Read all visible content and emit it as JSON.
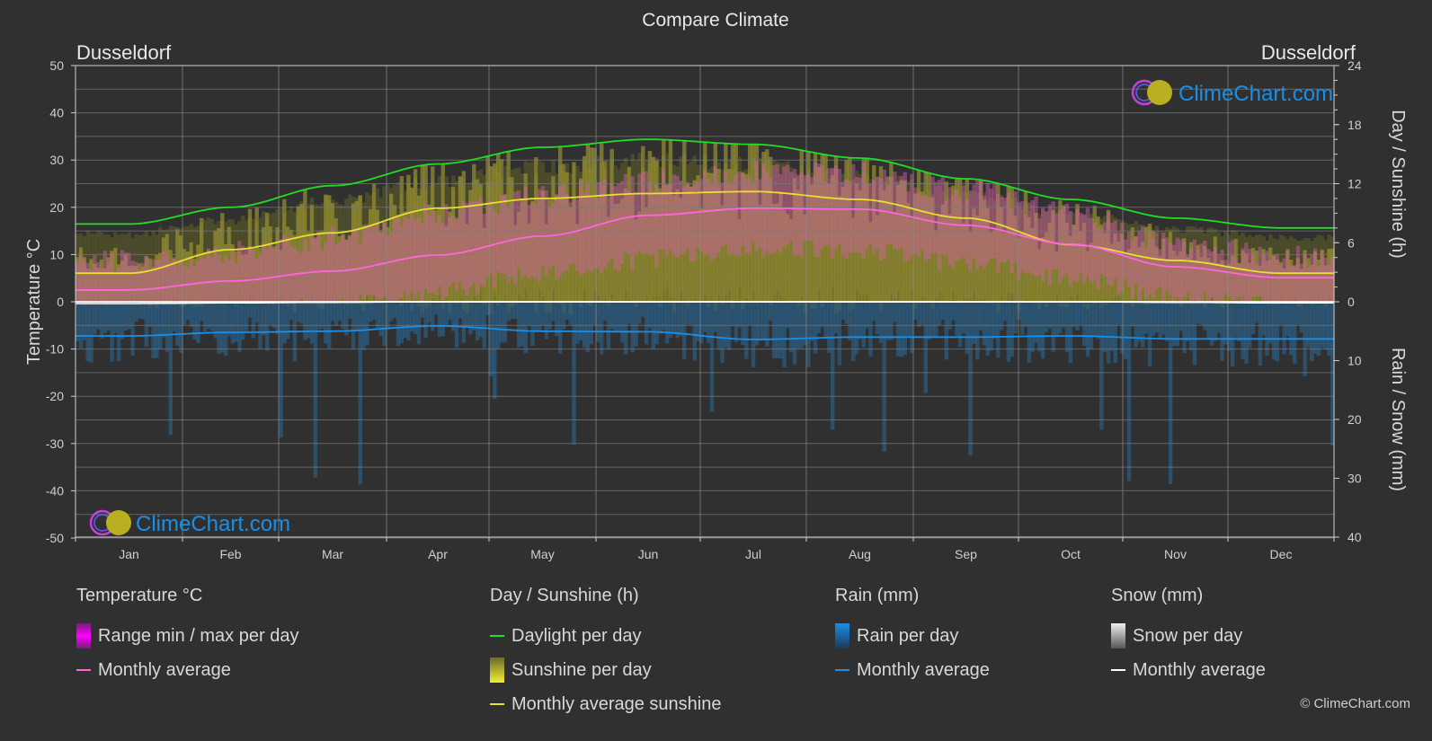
{
  "chart_data": {
    "type": "line",
    "title": "Compare Climate",
    "location_left": "Dusseldorf",
    "location_right": "Dusseldorf",
    "categories": [
      "Jan",
      "Feb",
      "Mar",
      "Apr",
      "May",
      "Jun",
      "Jul",
      "Aug",
      "Sep",
      "Oct",
      "Nov",
      "Dec"
    ],
    "y_left": {
      "label": "Temperature °C",
      "range": [
        -50,
        50
      ],
      "ticks": [
        50,
        40,
        30,
        20,
        10,
        0,
        -10,
        -20,
        -30,
        -40,
        -50
      ]
    },
    "y_right_top": {
      "label": "Day / Sunshine (h)",
      "range": [
        0,
        24
      ],
      "ticks": [
        24,
        18,
        12,
        6,
        0
      ]
    },
    "y_right_bottom": {
      "label": "Rain / Snow (mm)",
      "range": [
        0,
        40
      ],
      "ticks": [
        0,
        10,
        20,
        30,
        40
      ]
    },
    "grid": true,
    "series": [
      {
        "name": "Daylight per day",
        "axis": "sun",
        "color": "#22dd22",
        "values": [
          7.9,
          9.6,
          11.8,
          14.0,
          15.7,
          16.5,
          16.0,
          14.6,
          12.5,
          10.4,
          8.5,
          7.5
        ]
      },
      {
        "name": "Monthly average sunshine",
        "axis": "sun",
        "color": "#e8e030",
        "values": [
          2.9,
          5.3,
          7.0,
          9.5,
          10.5,
          11.0,
          11.2,
          10.4,
          8.5,
          5.8,
          4.2,
          2.9
        ]
      },
      {
        "name": "Temperature monthly average",
        "axis": "temp",
        "color": "#ff66dd",
        "values": [
          2.5,
          4.4,
          6.5,
          9.9,
          13.9,
          18.3,
          19.8,
          19.6,
          16.2,
          12.2,
          7.4,
          5.1
        ]
      },
      {
        "name": "Rain monthly average",
        "axis": "rain",
        "color": "#1a8fe8",
        "values": [
          5.8,
          5.2,
          5.0,
          4.1,
          5.0,
          5.1,
          6.4,
          6.0,
          6.0,
          5.8,
          6.3,
          6.3
        ]
      },
      {
        "name": "Snow monthly average",
        "axis": "rain",
        "color": "#ffffff",
        "values": [
          0.3,
          0.2,
          0.1,
          0,
          0,
          0,
          0,
          0,
          0,
          0,
          0.1,
          0.2
        ]
      }
    ],
    "temp_range_approx": {
      "min": [
        -1,
        0,
        1,
        4,
        8,
        11,
        13,
        13,
        10,
        7,
        3,
        1
      ],
      "max": [
        6,
        8,
        11,
        16,
        20,
        23,
        25,
        25,
        21,
        16,
        10,
        7
      ]
    },
    "watermark": "ClimeChart.com"
  },
  "legend": {
    "temperature": {
      "title": "Temperature °C",
      "range": "Range min / max per day",
      "avg": "Monthly average"
    },
    "sun": {
      "title": "Day / Sunshine (h)",
      "daylight": "Daylight per day",
      "sunshine": "Sunshine per day",
      "avg": "Monthly average sunshine"
    },
    "rain": {
      "title": "Rain (mm)",
      "per_day": "Rain per day",
      "avg": "Monthly average"
    },
    "snow": {
      "title": "Snow (mm)",
      "per_day": "Snow per day",
      "avg": "Monthly average"
    }
  },
  "copyright": "© ClimeChart.com"
}
